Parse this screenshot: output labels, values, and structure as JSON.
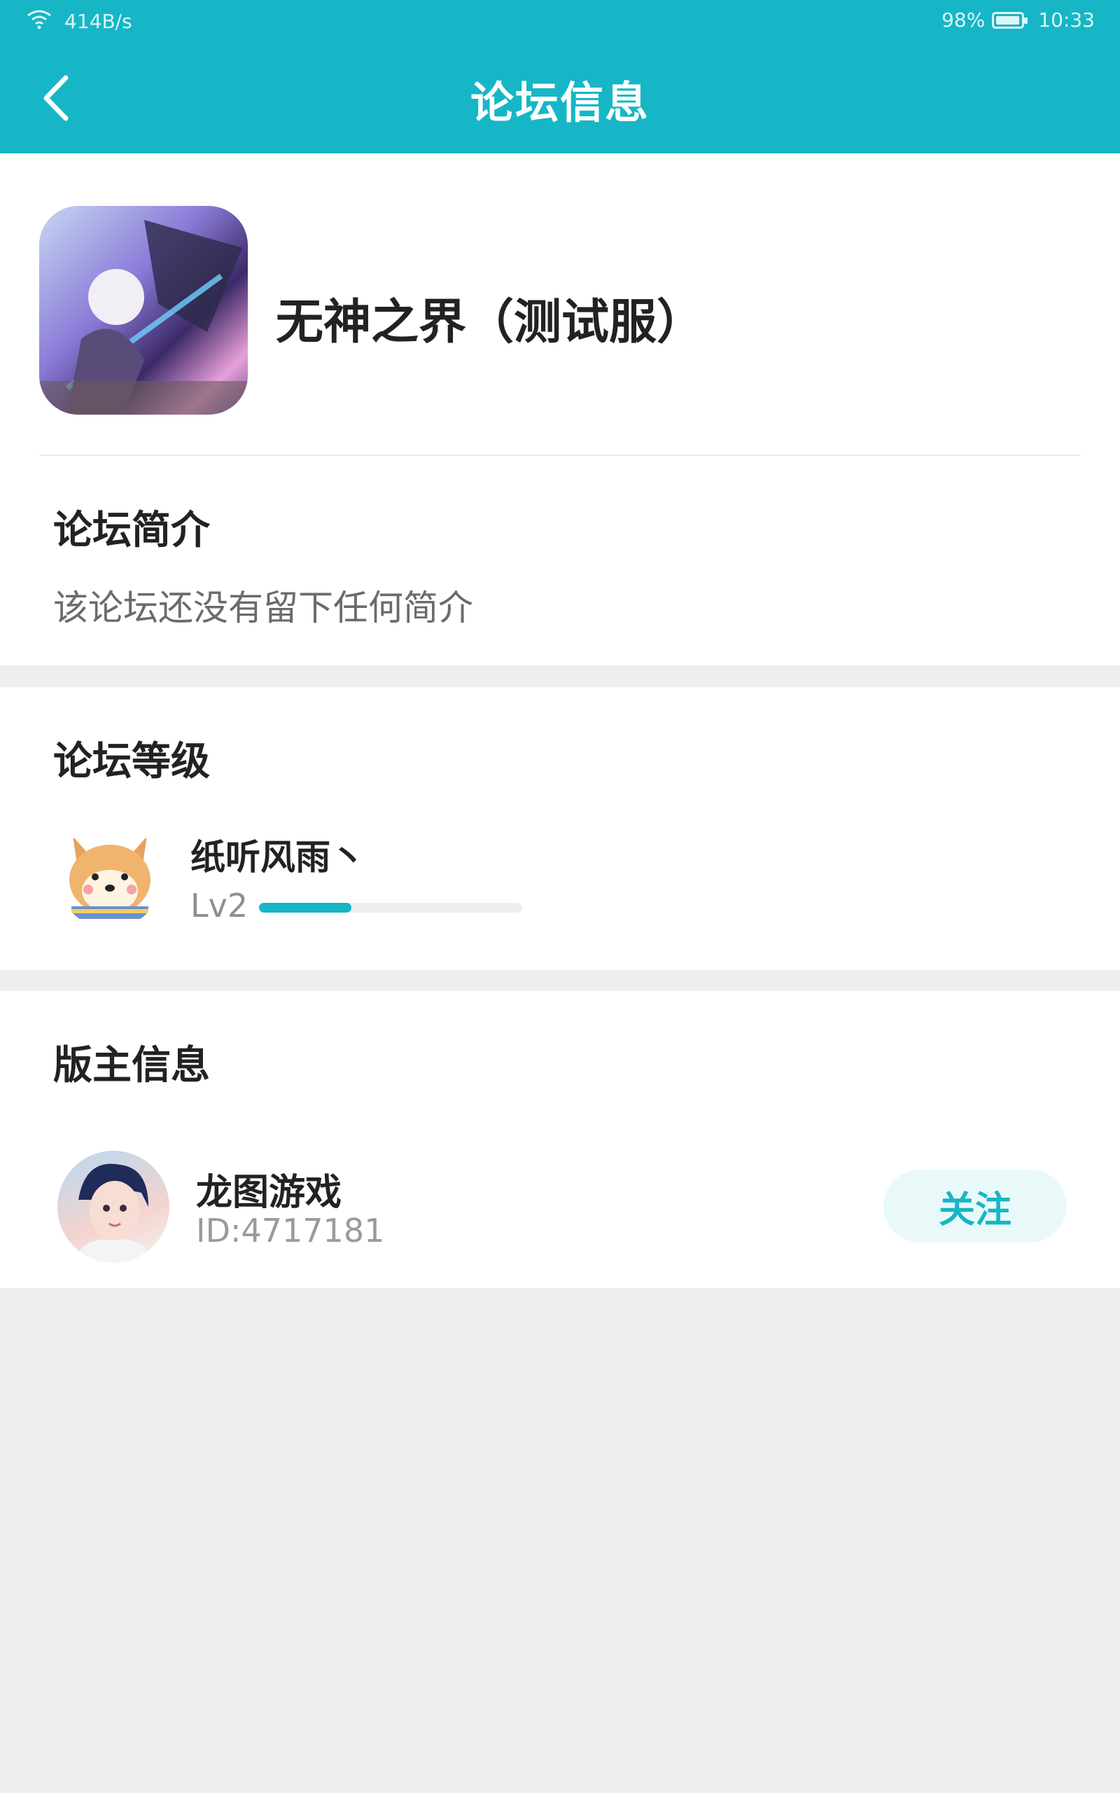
{
  "status_bar": {
    "network_speed": "414B/s",
    "battery": "98%",
    "time": "10:33",
    "battery_level": 0.98,
    "icons": [
      "wifi-icon",
      "battery-icon"
    ]
  },
  "header": {
    "title": "论坛信息",
    "back_icon": "chevron-left-icon",
    "background_color": "#16b6c6"
  },
  "forum": {
    "name": "无神之界（测试服）"
  },
  "intro": {
    "title": "论坛简介",
    "text": "该论坛还没有留下任何简介"
  },
  "level": {
    "title": "论坛等级",
    "user_name": "纸听风雨丶",
    "level_label": "Lv2",
    "progress": 0.35
  },
  "moderator": {
    "title": "版主信息",
    "name": "龙图游戏",
    "id_text": "ID:4717181",
    "follow_label": "关注"
  },
  "colors": {
    "accent": "#16b6c6",
    "page_background": "#eeeeee",
    "follow_button_bg": "#e9f9fa"
  }
}
